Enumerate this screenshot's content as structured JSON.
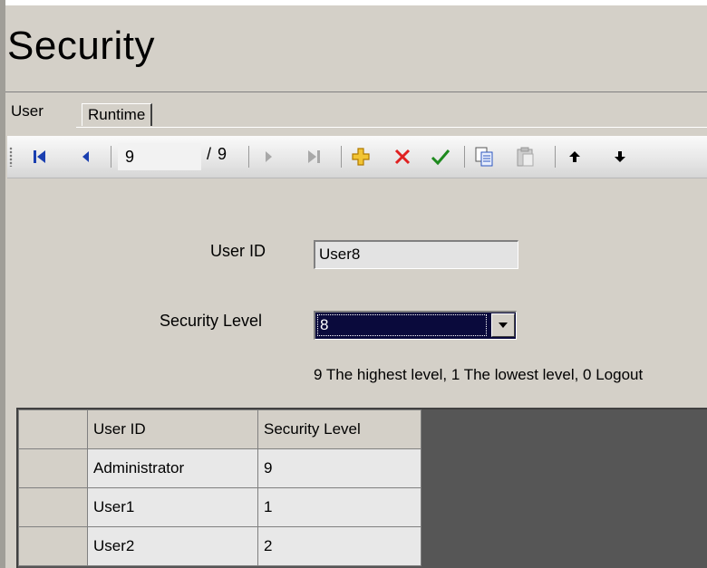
{
  "window": {
    "title": "Security"
  },
  "tabs": [
    {
      "label": "User",
      "active": true
    },
    {
      "label": "Runtime",
      "active": false
    }
  ],
  "navigator": {
    "position": "9",
    "total": "/ 9",
    "icons": [
      "first-record-icon",
      "previous-record-icon",
      "next-record-icon",
      "last-record-icon",
      "add-icon",
      "delete-icon",
      "apply-icon",
      "copy-icon",
      "paste-icon",
      "move-up-icon",
      "move-down-icon"
    ]
  },
  "form": {
    "user_id_label": "User ID",
    "user_id_value": "User8",
    "security_level_label": "Security Level",
    "security_level_value": "8",
    "hint": "9 The highest level, 1 The lowest level, 0 Logout"
  },
  "grid": {
    "columns": [
      "User ID",
      "Security Level"
    ],
    "rows": [
      [
        "Administrator",
        "9"
      ],
      [
        "User1",
        "1"
      ],
      [
        "User2",
        "2"
      ]
    ]
  },
  "colors": {
    "background": "#d4d0c8",
    "grid_empty": "#565656",
    "selection": "#0a0a3c"
  }
}
